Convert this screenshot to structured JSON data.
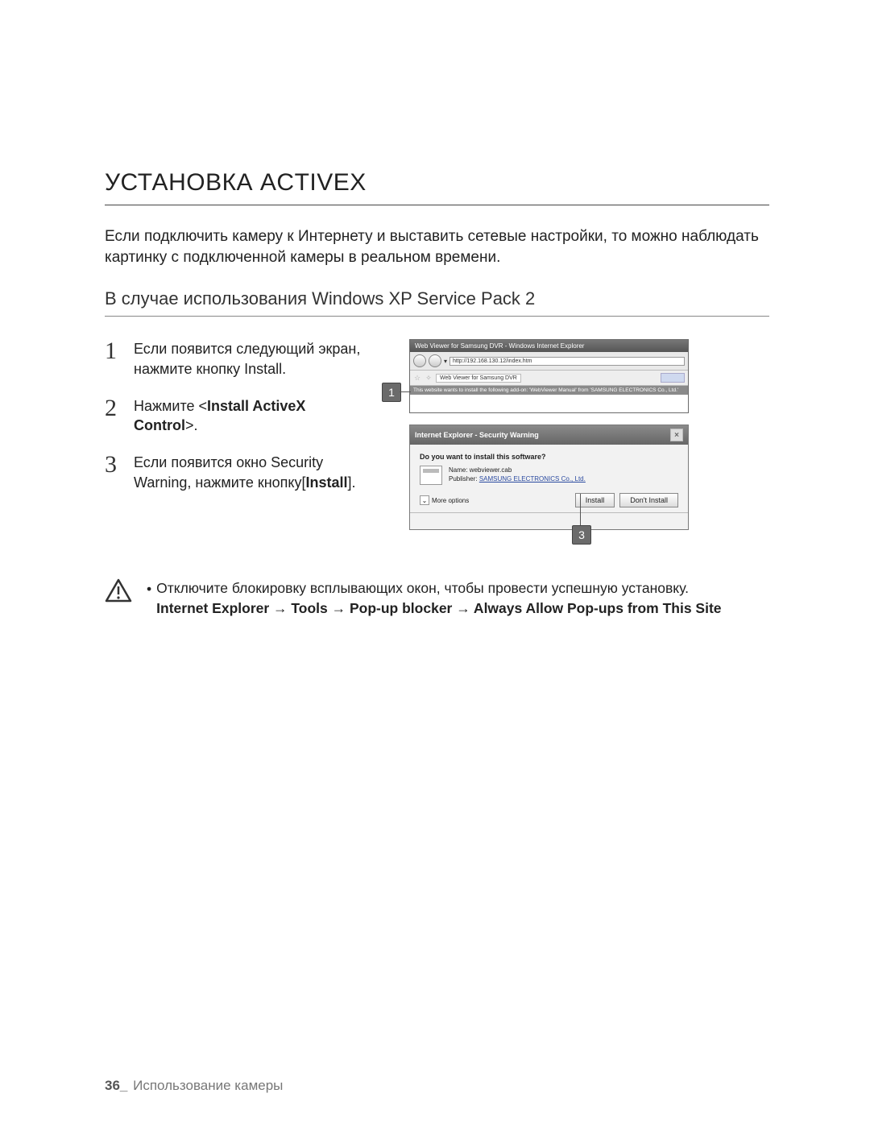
{
  "page": {
    "number": "36_",
    "section": "Использование камеры"
  },
  "heading": "УСТАНОВКА ACTIVEX",
  "intro": "Если подключить камеру к Интернету и выставить сетевые настройки, то можно наблюдать картинку с подключенной камеры в реальном времени.",
  "subheading": "В случае использования Windows XP Service Pack 2",
  "steps": [
    {
      "n": "1",
      "t": "Если появится следующий экран, нажмите кнопку Install."
    },
    {
      "n": "2",
      "t_pre": "Нажмите <",
      "t_bold": "Install ActiveX Control",
      "t_post": ">."
    },
    {
      "n": "3",
      "t_pre": "Если появится окно Security Warning, нажмите кнопку[",
      "t_bold": "Install",
      "t_post": "]."
    }
  ],
  "callouts": {
    "c1": "1",
    "c3": "3"
  },
  "browser": {
    "title": "Web Viewer for Samsung DVR - Windows Internet Explorer",
    "url": "http://192.168.130.12/index.htm",
    "tab": "Web Viewer for Samsung DVR",
    "infobar": "This website wants to install the following add-on: 'WebViewer Manual' from 'SAMSUNG ELECTRONICS Co., Ltd.'"
  },
  "dialog": {
    "title": "Internet Explorer - Security Warning",
    "question": "Do you want to install this software?",
    "name_label": "Name:",
    "name": "webviewer.cab",
    "publisher_label": "Publisher:",
    "publisher": "SAMSUNG ELECTRONICS Co., Ltd.",
    "more": "More options",
    "install": "Install",
    "dont": "Don't Install"
  },
  "note": {
    "sentence": "Отключите блокировку всплывающих окон, чтобы провести успешную установку.",
    "path": "Internet Explorer → Tools → Pop-up blocker → Always Allow Pop-ups from This Site"
  }
}
